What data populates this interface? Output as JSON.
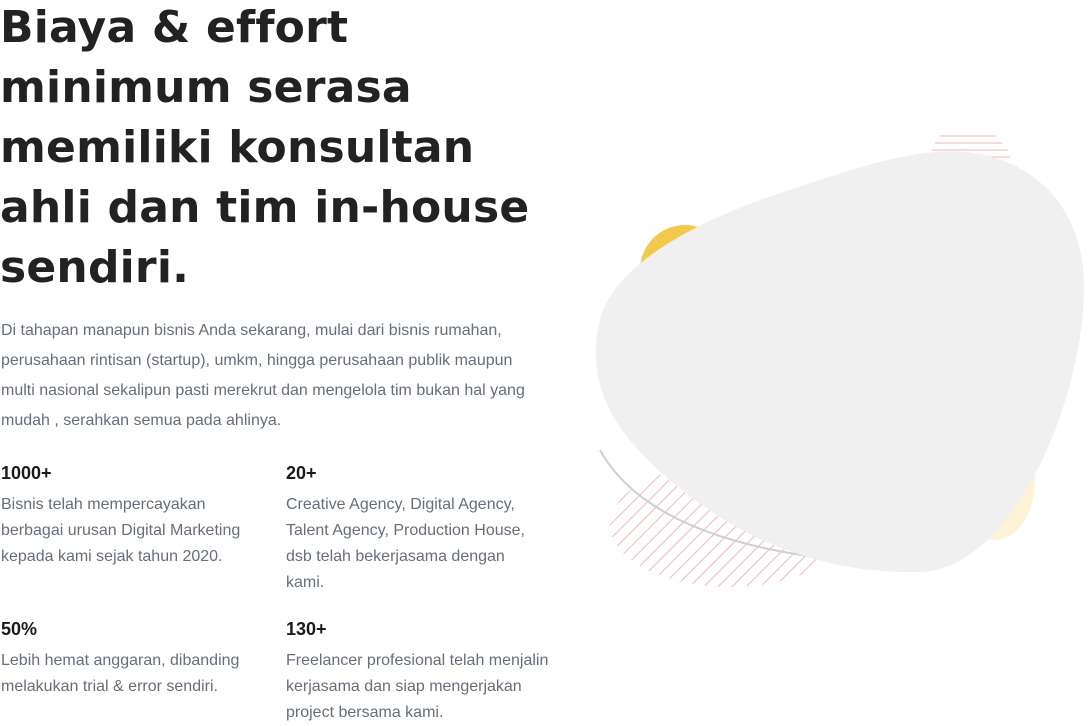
{
  "hero": {
    "headline": "Biaya & effort minimum serasa memiliki konsultan ahli dan tim in-house sendiri.",
    "intro": "Di tahapan manapun bisnis Anda sekarang, mulai dari bisnis rumahan, perusahaan rintisan (startup), umkm, hingga perusahaan publik maupun multi nasional sekalipun pasti merekrut dan mengelola tim bukan hal yang mudah , serahkan semua pada ahlinya."
  },
  "stats": [
    {
      "value": "1000+",
      "description": "Bisnis telah mempercayakan berbagai urusan Digital Marketing kepada kami sejak tahun 2020."
    },
    {
      "value": "20+",
      "description": "Creative Agency, Digital Agency, Talent Agency, Production House, dsb telah bekerjasama dengan kami."
    },
    {
      "value": "50%",
      "description": "Lebih hemat anggaran, dibanding melakukan trial & error sendiri."
    },
    {
      "value": "130+",
      "description": "Freelancer profesional telah menjalin kerjasama dan siap mengerjakan project bersama kami."
    }
  ],
  "colors": {
    "heading": "#222222",
    "body_text": "#666e7a",
    "blob": "#f0f0f0",
    "accent_yellow": "#f3c94c",
    "accent_stripes": "#f2b8b8"
  },
  "decoration": {
    "icon": "abstract-blob-illustration"
  }
}
